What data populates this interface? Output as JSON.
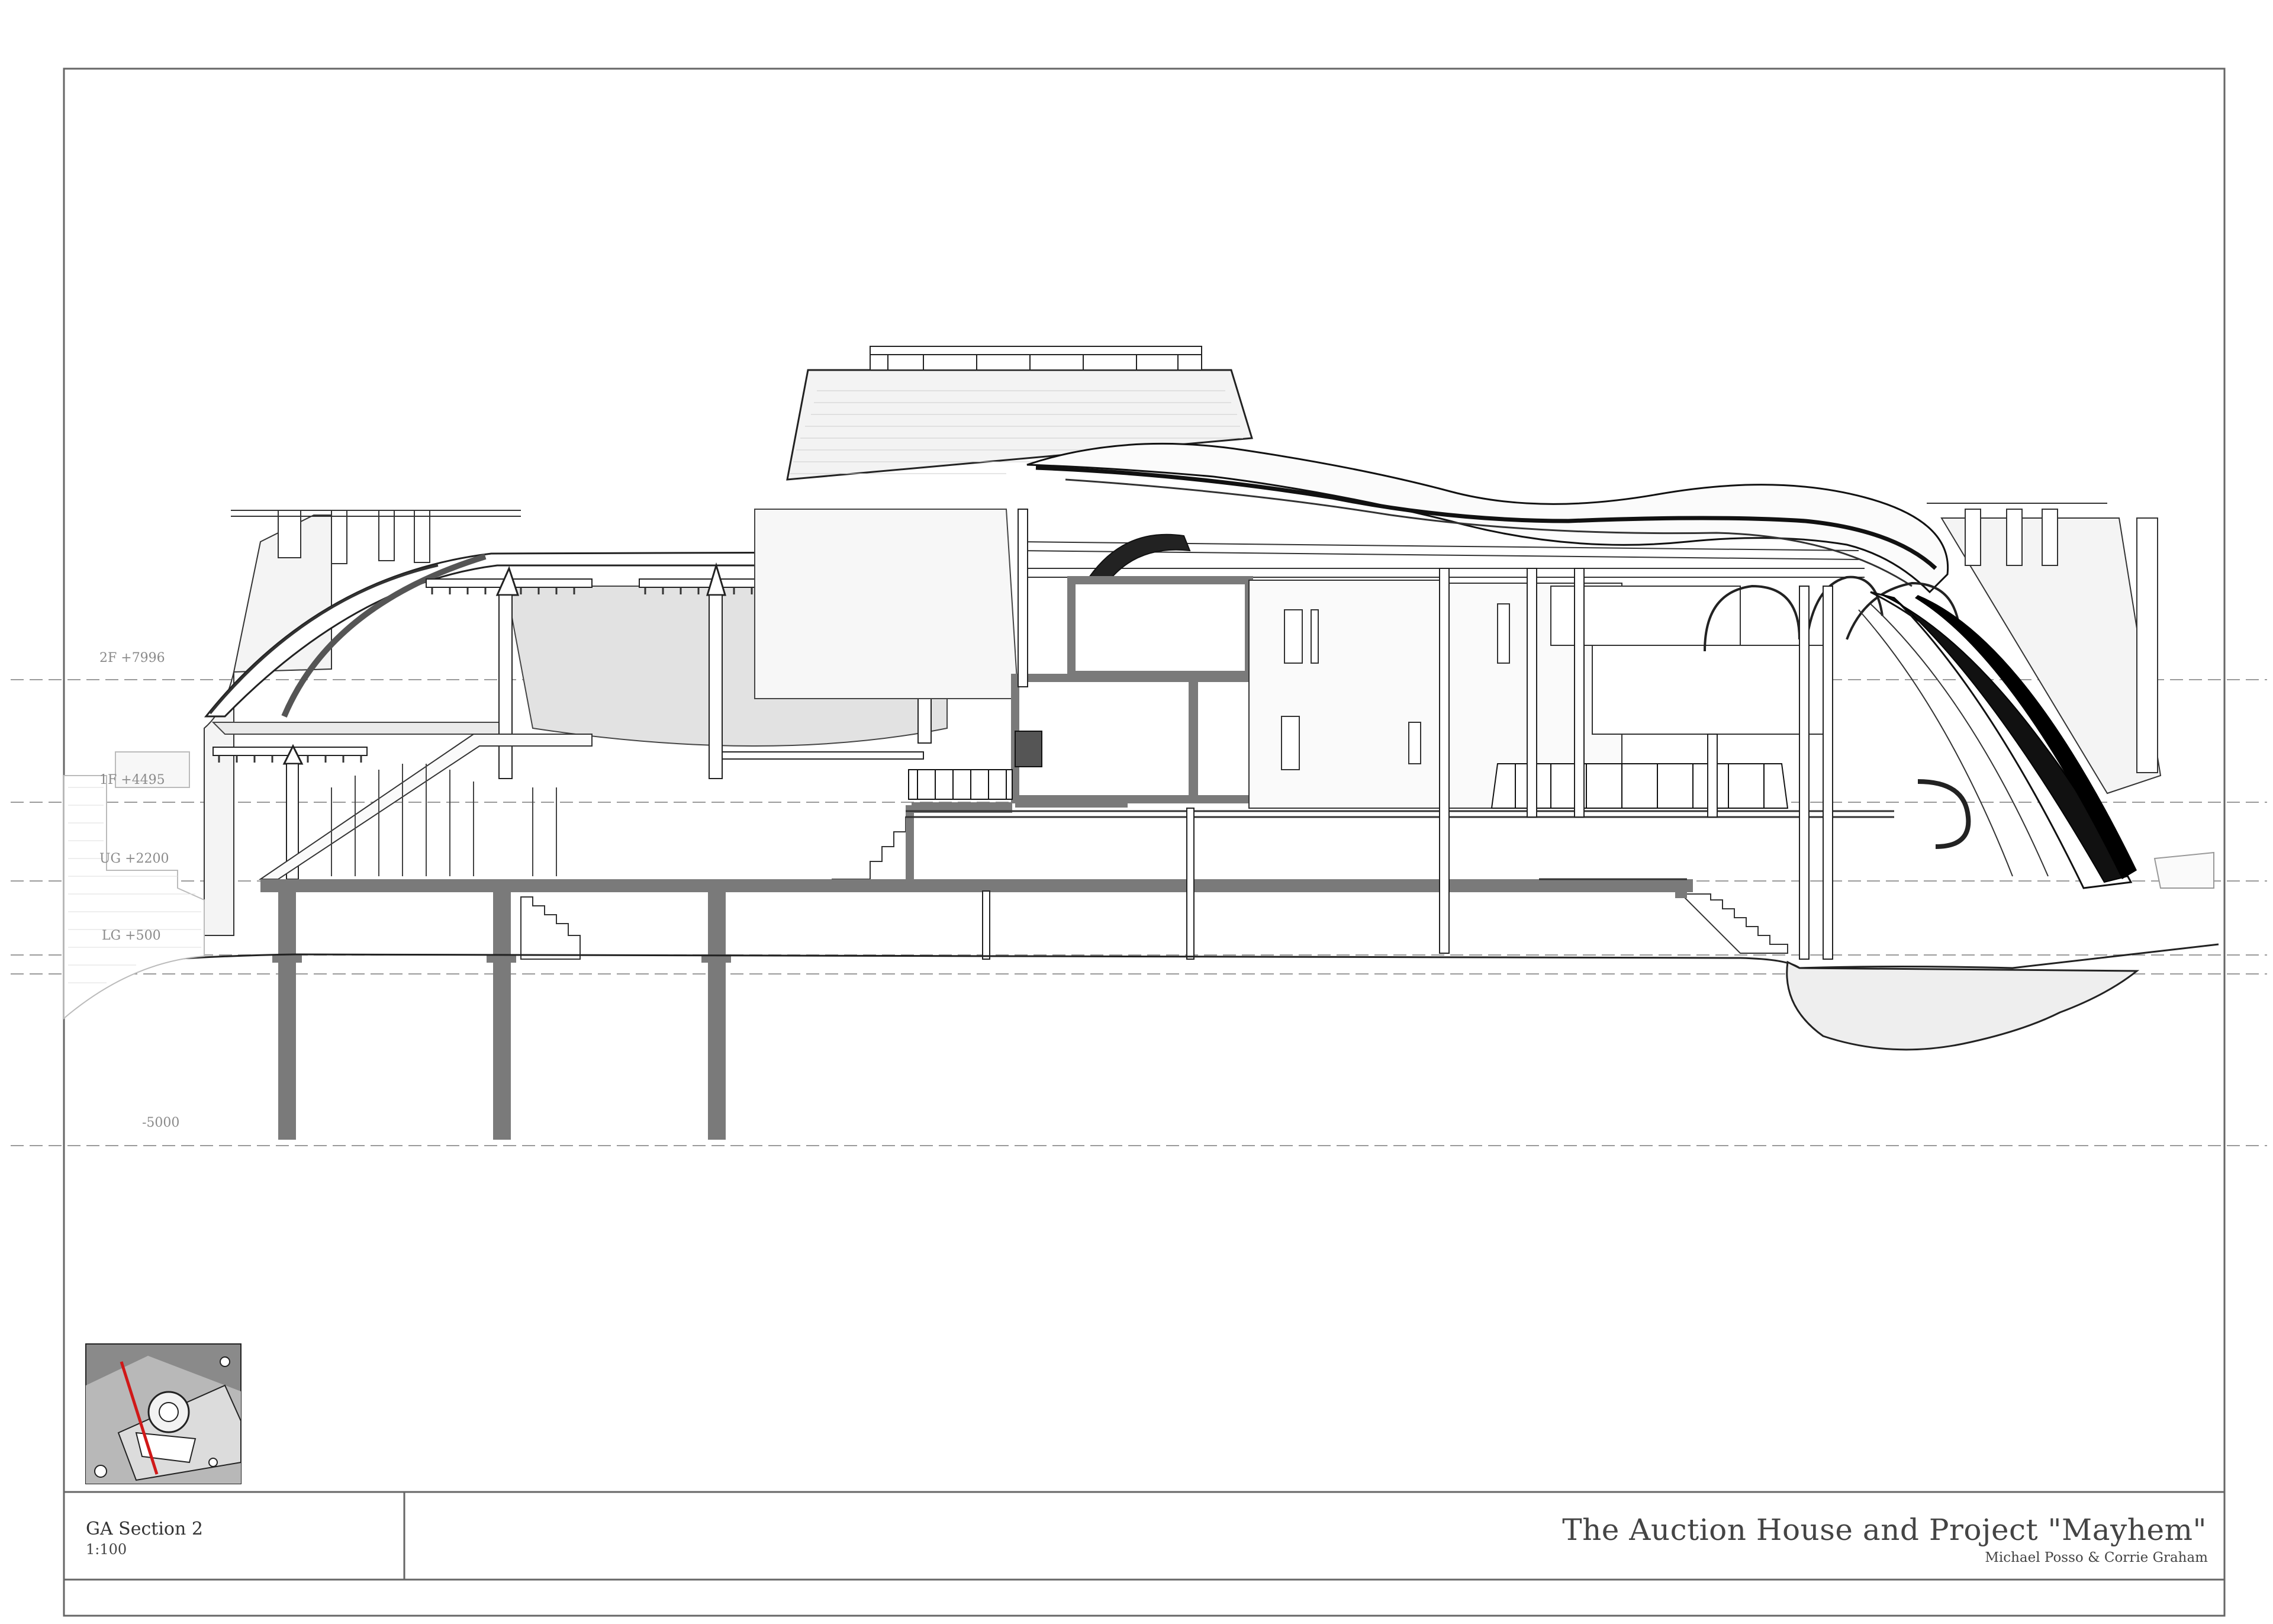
{
  "levels": [
    {
      "label": "2F +7996"
    },
    {
      "label": "1F +4495"
    },
    {
      "label": "UG +2200"
    },
    {
      "label": "LG +500"
    },
    {
      "label": "-5000"
    }
  ],
  "title_block": {
    "drawing_title": "GA Section 2",
    "scale": "1:100",
    "project_title": "The Auction House and Project \"Mayhem\"",
    "authors": "Michael Posso & Corrie Graham"
  },
  "key_plan": {
    "icon": "site-key-plan-icon",
    "marker_color": "#d01818"
  },
  "colors": {
    "frame": "#666666",
    "cut_structure": "#7a7a7a",
    "cut_fill": "#e2e2e2",
    "line": "#222222",
    "level_line": "#9a9a9a",
    "dark_facade": "#111111"
  }
}
